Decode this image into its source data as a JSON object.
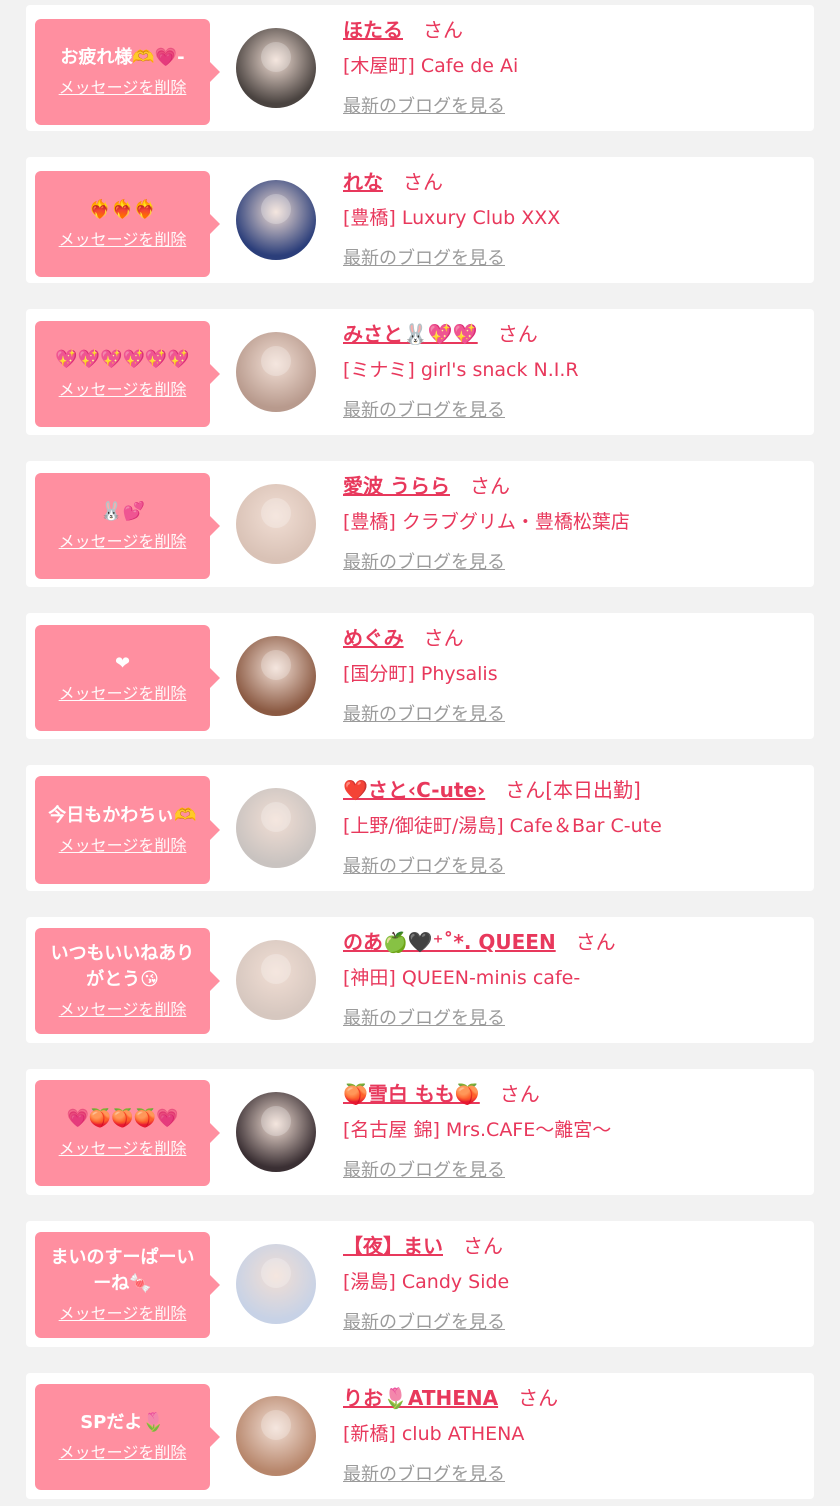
{
  "items": [
    {
      "message": "お疲れ様🫶💗-",
      "delete_label": "メッセージを削除",
      "name": "ほたる",
      "honorific": "さん",
      "status": "",
      "shop": "[木屋町] Cafe de Ai",
      "blog_label": "最新のブログを見る",
      "avatar_color": "#4a4340"
    },
    {
      "message": "❤️‍🔥❤️‍🔥❤️‍🔥",
      "delete_label": "メッセージを削除",
      "name": "れな",
      "honorific": "さん",
      "status": "",
      "shop": "[豊橋] Luxury Club XXX",
      "blog_label": "最新のブログを見る",
      "avatar_color": "#2b3e7a"
    },
    {
      "message": "💖💖💖💖💖💖",
      "delete_label": "メッセージを削除",
      "name": "みさと🐰💖💖",
      "honorific": "さん",
      "status": "",
      "shop": "[ミナミ] girl's snack N.I.R",
      "blog_label": "最新のブログを見る",
      "avatar_color": "#b89a8d"
    },
    {
      "message": "🐰💕",
      "delete_label": "メッセージを削除",
      "name": "愛波 うらら",
      "honorific": "さん",
      "status": "",
      "shop": "[豊橋] クラブグリム・豊橋松葉店",
      "blog_label": "最新のブログを見る",
      "avatar_color": "#d9c2b6"
    },
    {
      "message": "❤",
      "delete_label": "メッセージを削除",
      "name": "めぐみ",
      "honorific": "さん",
      "status": "",
      "shop": "[国分町] Physalis",
      "blog_label": "最新のブログを見る",
      "avatar_color": "#8b5a43"
    },
    {
      "message": "今日もかわちぃ🫶",
      "delete_label": "メッセージを削除",
      "name": "❤️さと‹C-ute›",
      "honorific": "さん",
      "status": "[本日出勤]",
      "shop": "[上野/御徒町/湯島] Cafe＆Bar C-ute",
      "blog_label": "最新のブログを見る",
      "avatar_color": "#c9c3c0"
    },
    {
      "message": "いつもいいねありがとう😘",
      "delete_label": "メッセージを削除",
      "name": "のあ🍏🖤⁺˚*. QUEEN",
      "honorific": "さん",
      "status": "",
      "shop": "[神田] QUEEN-minis cafe-",
      "blog_label": "最新のブログを見る",
      "avatar_color": "#d6c7bf"
    },
    {
      "message": "💗🍑🍑🍑💗",
      "delete_label": "メッセージを削除",
      "name": "🍑雪白 もも🍑",
      "honorific": "さん",
      "status": "",
      "shop": "[名古屋 錦] Mrs.CAFE〜離宮〜",
      "blog_label": "最新のブログを見る",
      "avatar_color": "#3a2f33"
    },
    {
      "message": "まいのすーぱーいーね🍬",
      "delete_label": "メッセージを削除",
      "name": "【夜】まい",
      "honorific": "さん",
      "status": "",
      "shop": "[湯島] Candy Side",
      "blog_label": "最新のブログを見る",
      "avatar_color": "#c7d2e6"
    },
    {
      "message": "SPだよ🌷",
      "delete_label": "メッセージを削除",
      "name": "りお🌷ATHENA",
      "honorific": "さん",
      "status": "",
      "shop": "[新橋] club ATHENA",
      "blog_label": "最新のブログを見る",
      "avatar_color": "#b7866b"
    }
  ]
}
